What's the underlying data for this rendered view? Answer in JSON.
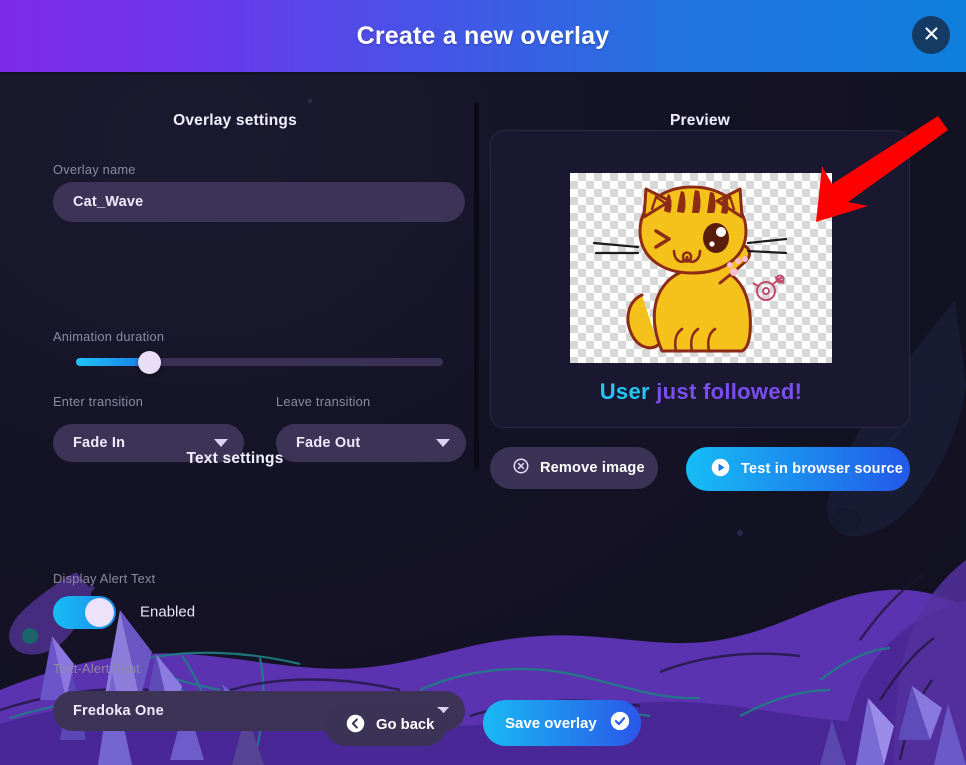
{
  "header": {
    "title": "Create a new overlay",
    "close_icon": "close-icon",
    "gradient_from": "#7c2ae8",
    "gradient_to": "#0f7fdc"
  },
  "overlay_settings": {
    "section_title": "Overlay settings",
    "name_label": "Overlay name",
    "name_value": "Cat_Wave",
    "name_placeholder": "Overlay name",
    "duration_label": "Animation duration",
    "duration_percent": 20,
    "enter_label": "Enter transition",
    "enter_value": "Fade In",
    "leave_label": "Leave transition",
    "leave_value": "Fade Out",
    "caret_icon": "chevron-down-icon"
  },
  "text_settings": {
    "section_title": "Text settings",
    "display_alert_label": "Display Alert Text",
    "toggle_state": "Enabled",
    "toggle_on": true,
    "font_label": "Text-Alert Font",
    "font_value": "Fredoka One"
  },
  "preview": {
    "section_title": "Preview",
    "image_icon": "waving-cat-image",
    "alert_text_primary": "User",
    "alert_text_secondary": " just followed!",
    "primary_color": "#22c8f5",
    "secondary_color": "#7b4ef0",
    "remove_button": "Remove image",
    "remove_icon": "circle-x-icon",
    "test_button": "Test in browser source",
    "test_icon": "play-icon"
  },
  "footer": {
    "back_button": "Go back",
    "back_icon": "arrow-left-circle-icon",
    "save_button": "Save overlay",
    "save_icon": "check-circle-icon"
  },
  "annotation": {
    "arrow_icon": "red-arrow-icon",
    "color": "#ff0000"
  }
}
